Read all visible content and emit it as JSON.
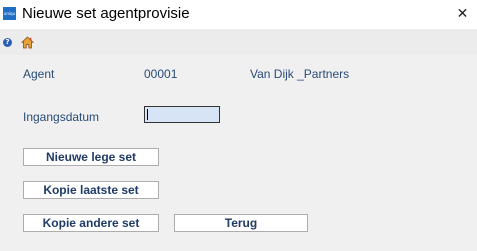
{
  "window": {
    "title": "Nieuwe set agentprovisie",
    "app_icon_text": "uniqu",
    "close_glyph": "✕"
  },
  "toolbar": {
    "help_glyph": "?",
    "home_icon": "home-icon"
  },
  "agent": {
    "label": "Agent",
    "code": "00001",
    "name": "Van Dijk _Partners"
  },
  "ingangsdatum": {
    "label": "Ingangsdatum",
    "value": ""
  },
  "buttons": {
    "nieuwe_lege_set": "Nieuwe lege set",
    "kopie_laatste_set": "Kopie laatste set",
    "kopie_andere_set": "Kopie andere set",
    "terug": "Terug"
  },
  "colors": {
    "label_text": "#2a4b78",
    "input_bg": "#d6e4f5",
    "app_icon": "#1f6fc4"
  }
}
